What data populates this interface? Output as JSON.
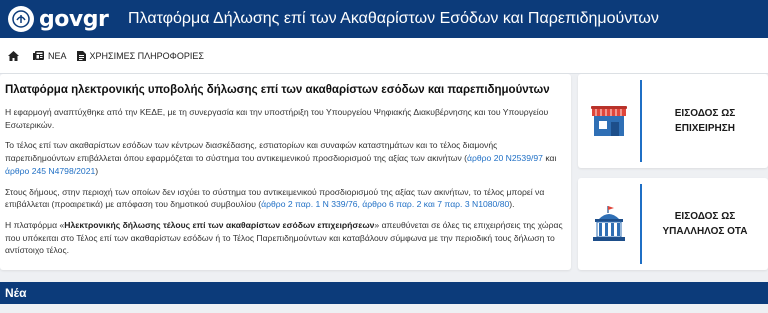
{
  "header": {
    "logo_text": "govgr",
    "title": "Πλατφόρμα Δήλωσης επί των Ακαθαρίστων Εσόδων και Παρεπιδημούντων"
  },
  "nav": {
    "items": [
      {
        "label": ""
      },
      {
        "label": "ΝΕΑ"
      },
      {
        "label": "ΧΡΗΣΙΜΕΣ ΠΛΗΡΟΦΟΡΙΕΣ"
      }
    ]
  },
  "main": {
    "heading": "Πλατφόρμα ηλεκτρονικής υποβολής δήλωσης επί των ακαθαρίστων εσόδων και παρεπιδημούντων",
    "p1": "Η εφαρμογή αναπτύχθηκε από την ΚΕΔΕ, με τη συνεργασία και την υποστήριξη του Υπουργείου Ψηφιακής Διακυβέρνησης και του Υπουργείου Εσωτερικών.",
    "p2_text": "Το τέλος επί των ακαθαρίστων εσόδων των κέντρων διασκέδασης, εστιατορίων και συναφών καταστημάτων και το τέλος διαμονής παρεπιδημούντων επιβάλλεται όπου εφαρμόζεται το σύστημα του αντικειμενικού προσδιορισμού της αξίας των ακινήτων",
    "p2_link1": "άρθρο 20 Ν2539/97",
    "p2_mid": "και",
    "p2_link2": "άρθρο 245 Ν4798/2021",
    "p3_text": "Στους δήμους, στην περιοχή των οποίων δεν ισχύει το σύστημα του αντικειμενικού προσδιορισμού της αξίας των ακινήτων, το τέλος μπορεί να επιβάλλεται (προαιρετικά) με απόφαση του δημοτικού συμβουλίου",
    "p3_link": "άρθρο 2 παρ. 1 Ν 339/76, άρθρο 6 παρ. 2 και 7 παρ. 3 Ν1080/80",
    "p4_pre": "Η πλατφόρμα «",
    "p4_bold": "Ηλεκτρονικής δήλωσης τέλους επί των ακαθαρίστων εσόδων επιχειρήσεων",
    "p4_post": "» απευθύνεται σε όλες τις επιχειρήσεις της χώρας που υπόκειται στο Τέλος επί των ακαθαρίστων εσόδων ή το Τέλος Παρεπιδημούντων και καταβάλουν σύμφωνα με την περιοδική τους δήλωση το αντίστοιχο τέλος."
  },
  "cards": [
    {
      "line1": "ΕΙΣΟΔΟΣ ΩΣ",
      "line2": "ΕΠΙΧΕΙΡΗΣΗ",
      "icon": "store-icon"
    },
    {
      "line1": "ΕΙΣΟΔΟΣ ΩΣ",
      "line2": "ΥΠΑΛΛΗΛΟΣ ΟΤΑ",
      "icon": "town-hall-icon"
    }
  ],
  "news": {
    "title": "Νέα"
  },
  "colors": {
    "primary": "#0c3b7a",
    "link": "#1f6fc5",
    "background": "#eef0f3",
    "store_awning": "#e0463b",
    "store_body": "#2f6fb5"
  }
}
